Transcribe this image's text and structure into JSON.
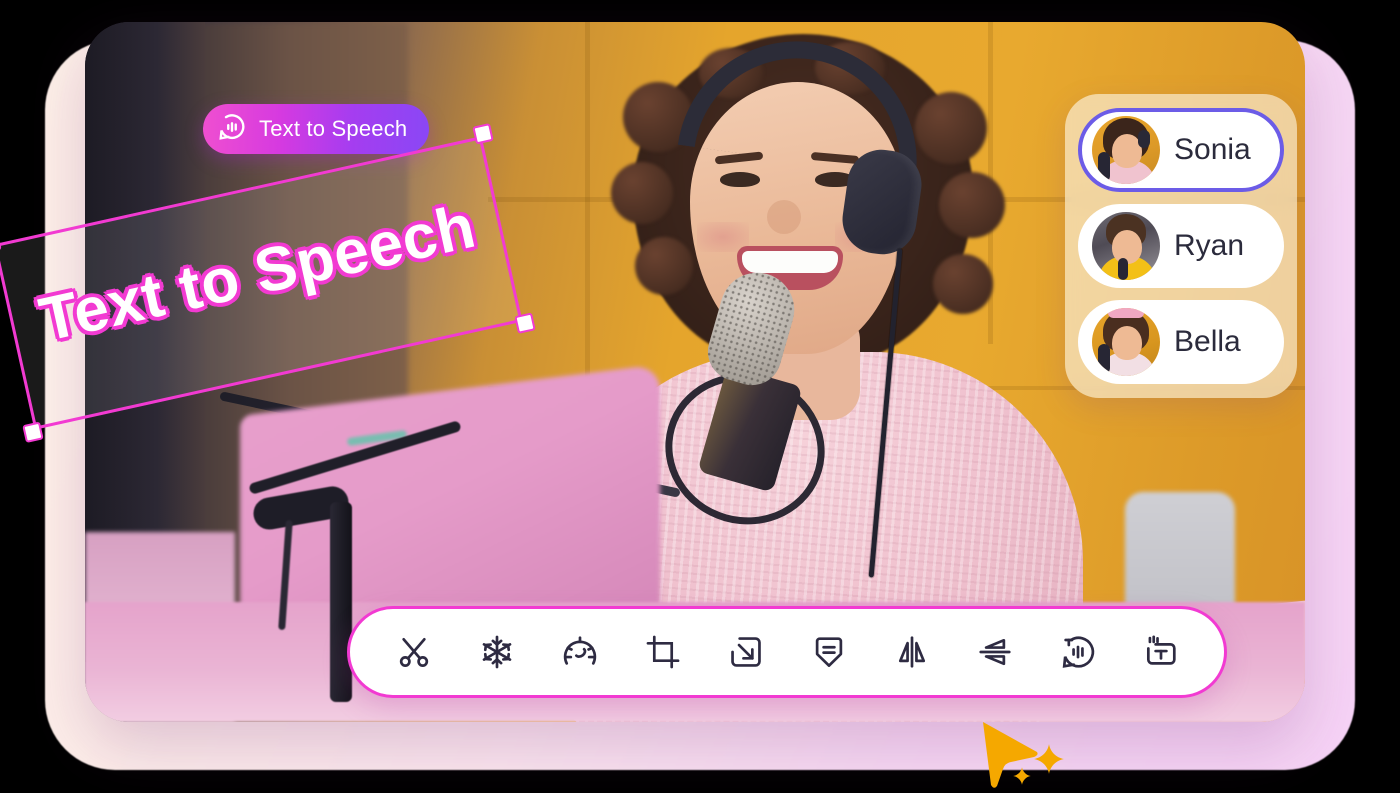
{
  "badge": {
    "label": "Text to Speech",
    "icon": "speech-bubble-waveform-icon",
    "gradient_from": "#ef4fd0",
    "gradient_to": "#8a47f5"
  },
  "canvas": {
    "text_layer": {
      "text": "Text to Speech",
      "selected": true,
      "rotation_deg": -12.5,
      "selection_color": "#f23ad2",
      "handles": [
        "top-left",
        "top-right",
        "bottom-left",
        "bottom-right"
      ]
    },
    "photo_description": "Woman with headphones smiling at a studio microphone"
  },
  "voice_panel": {
    "selected_index": 0,
    "selected_border_color": "#6c5ce7",
    "items": [
      {
        "name": "Sonia",
        "avatar": "sonia-avatar",
        "selected": true
      },
      {
        "name": "Ryan",
        "avatar": "ryan-avatar",
        "selected": false
      },
      {
        "name": "Bella",
        "avatar": "bella-avatar",
        "selected": false
      }
    ]
  },
  "toolbar": {
    "border_color": "#f23ad2",
    "icon_color": "#2e2b42",
    "tools": [
      {
        "name": "split-scissors",
        "label": "Split"
      },
      {
        "name": "freeze-snowflake",
        "label": "Freeze"
      },
      {
        "name": "speed-gauge",
        "label": "Speed"
      },
      {
        "name": "crop",
        "label": "Crop"
      },
      {
        "name": "resize-arrow-box",
        "label": "Resize"
      },
      {
        "name": "subtitle-shield",
        "label": "Subtitle"
      },
      {
        "name": "flip-horizontal",
        "label": "Flip Horizontal"
      },
      {
        "name": "flip-vertical",
        "label": "Flip Vertical"
      },
      {
        "name": "text-to-speech",
        "label": "Text to Speech"
      },
      {
        "name": "text-box",
        "label": "Text"
      }
    ]
  },
  "cursor": {
    "name": "pointer-cursor",
    "color": "#f5a800",
    "sparkles": 2
  }
}
